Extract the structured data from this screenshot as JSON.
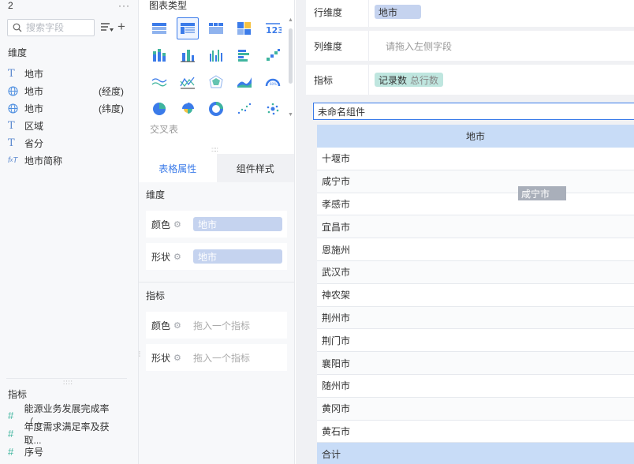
{
  "left_panel": {
    "header_num": "2",
    "more": "···",
    "search_placeholder": "搜索字段",
    "dimension_title": "维度",
    "dimension_fields": [
      {
        "icon": "text-field-icon",
        "name": "地市",
        "suffix": ""
      },
      {
        "icon": "globe-icon",
        "name": "地市",
        "suffix": "(经度)"
      },
      {
        "icon": "globe-icon",
        "name": "地市",
        "suffix": "(纬度)"
      },
      {
        "icon": "text-field-icon",
        "name": "区域",
        "suffix": ""
      },
      {
        "icon": "text-field-icon",
        "name": "省分",
        "suffix": ""
      },
      {
        "icon": "formula-icon",
        "name": "地市简称",
        "suffix": ""
      }
    ],
    "measure_title": "指标",
    "measure_fields": [
      {
        "icon": "hash-icon",
        "name": "能源业务发展完成率（..."
      },
      {
        "icon": "hash-icon",
        "name": "年度需求满足率及获取..."
      },
      {
        "icon": "hash-icon",
        "name": "序号"
      }
    ]
  },
  "chart_panel": {
    "title": "图表类型",
    "chart_types": [
      "grouped-table-icon",
      "cross-table-icon",
      "detail-table-icon",
      "heatmap-table-icon",
      "kpi-number-icon",
      "stacked-column-icon",
      "column-chart-icon",
      "multi-column-icon",
      "bar-chart-icon",
      "waterfall-icon",
      "line-chart-icon",
      "polyline-chart-icon",
      "radar-chart-icon",
      "area-chart-icon",
      "gauge-icon",
      "pie-chart-icon",
      "rose-chart-icon",
      "donut-chart-icon",
      "scatter-chart-icon",
      "bubble-chart-icon"
    ],
    "active_type_index": 1,
    "selected_type_label": "交叉表",
    "tabs": [
      "表格属性",
      "组件样式"
    ],
    "dimension_section": "维度",
    "dimension_props": [
      {
        "label": "颜色",
        "value": "地市"
      },
      {
        "label": "形状",
        "value": "地市"
      }
    ],
    "measure_section": "指标",
    "measure_props": [
      {
        "label": "颜色",
        "placeholder": "拖入一个指标"
      },
      {
        "label": "形状",
        "placeholder": "拖入一个指标"
      }
    ]
  },
  "canvas": {
    "row_dim_label": "行维度",
    "row_dim_value": "地市",
    "col_dim_label": "列维度",
    "col_dim_placeholder": "请拖入左侧字段",
    "measure_label": "指标",
    "measure_value": "记录数",
    "measure_sub": "总行数",
    "component_name": "未命名组件",
    "table_header": "地市",
    "rows": [
      "十堰市",
      "咸宁市",
      "孝感市",
      "宜昌市",
      "恩施州",
      "武汉市",
      "神农架",
      "荆州市",
      "荆门市",
      "襄阳市",
      "随州市",
      "黄冈市",
      "黄石市"
    ],
    "total_label": "合计",
    "drag_ghost": "咸宁市"
  }
}
